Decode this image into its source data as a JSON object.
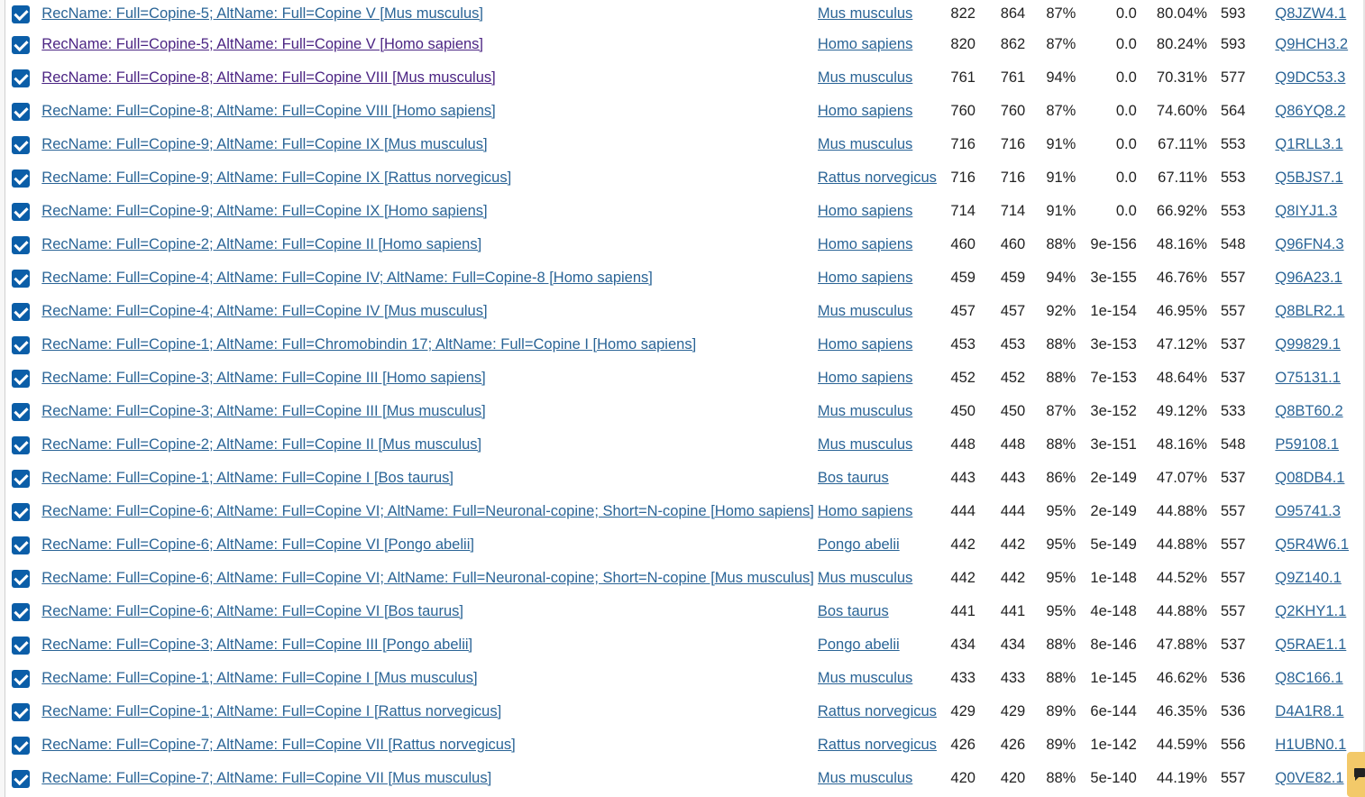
{
  "results": [
    {
      "description": "RecName: Full=Copine-5; AltName: Full=Copine V [Mus musculus]",
      "organism": "Mus musculus",
      "max_score": "822",
      "total_score": "864",
      "query_cover": "87%",
      "e_value": "0.0",
      "per_ident": "80.04%",
      "acc_len": "593",
      "accession": "Q8JZW4.1",
      "checked": true,
      "visited": false
    },
    {
      "description": "RecName: Full=Copine-5; AltName: Full=Copine V [Homo sapiens]",
      "organism": "Homo sapiens",
      "max_score": "820",
      "total_score": "862",
      "query_cover": "87%",
      "e_value": "0.0",
      "per_ident": "80.24%",
      "acc_len": "593",
      "accession": "Q9HCH3.2",
      "checked": true,
      "visited": true
    },
    {
      "description": "RecName: Full=Copine-8; AltName: Full=Copine VIII [Mus musculus]",
      "organism": "Mus musculus",
      "max_score": "761",
      "total_score": "761",
      "query_cover": "94%",
      "e_value": "0.0",
      "per_ident": "70.31%",
      "acc_len": "577",
      "accession": "Q9DC53.3",
      "checked": true,
      "visited": true
    },
    {
      "description": "RecName: Full=Copine-8; AltName: Full=Copine VIII [Homo sapiens]",
      "organism": "Homo sapiens",
      "max_score": "760",
      "total_score": "760",
      "query_cover": "87%",
      "e_value": "0.0",
      "per_ident": "74.60%",
      "acc_len": "564",
      "accession": "Q86YQ8.2",
      "checked": true,
      "visited": false
    },
    {
      "description": "RecName: Full=Copine-9; AltName: Full=Copine IX [Mus musculus]",
      "organism": "Mus musculus",
      "max_score": "716",
      "total_score": "716",
      "query_cover": "91%",
      "e_value": "0.0",
      "per_ident": "67.11%",
      "acc_len": "553",
      "accession": "Q1RLL3.1",
      "checked": true,
      "visited": false
    },
    {
      "description": "RecName: Full=Copine-9; AltName: Full=Copine IX [Rattus norvegicus]",
      "organism": "Rattus norvegicus",
      "max_score": "716",
      "total_score": "716",
      "query_cover": "91%",
      "e_value": "0.0",
      "per_ident": "67.11%",
      "acc_len": "553",
      "accession": "Q5BJS7.1",
      "checked": true,
      "visited": false
    },
    {
      "description": "RecName: Full=Copine-9; AltName: Full=Copine IX [Homo sapiens]",
      "organism": "Homo sapiens",
      "max_score": "714",
      "total_score": "714",
      "query_cover": "91%",
      "e_value": "0.0",
      "per_ident": "66.92%",
      "acc_len": "553",
      "accession": "Q8IYJ1.3",
      "checked": true,
      "visited": false
    },
    {
      "description": "RecName: Full=Copine-2; AltName: Full=Copine II [Homo sapiens]",
      "organism": "Homo sapiens",
      "max_score": "460",
      "total_score": "460",
      "query_cover": "88%",
      "e_value": "9e-156",
      "per_ident": "48.16%",
      "acc_len": "548",
      "accession": "Q96FN4.3",
      "checked": true,
      "visited": false
    },
    {
      "description": "RecName: Full=Copine-4; AltName: Full=Copine IV; AltName: Full=Copine-8 [Homo sapiens]",
      "organism": "Homo sapiens",
      "max_score": "459",
      "total_score": "459",
      "query_cover": "94%",
      "e_value": "3e-155",
      "per_ident": "46.76%",
      "acc_len": "557",
      "accession": "Q96A23.1",
      "checked": true,
      "visited": false
    },
    {
      "description": "RecName: Full=Copine-4; AltName: Full=Copine IV [Mus musculus]",
      "organism": "Mus musculus",
      "max_score": "457",
      "total_score": "457",
      "query_cover": "92%",
      "e_value": "1e-154",
      "per_ident": "46.95%",
      "acc_len": "557",
      "accession": "Q8BLR2.1",
      "checked": true,
      "visited": false
    },
    {
      "description": "RecName: Full=Copine-1; AltName: Full=Chromobindin 17; AltName: Full=Copine I [Homo sapiens]",
      "organism": "Homo sapiens",
      "max_score": "453",
      "total_score": "453",
      "query_cover": "88%",
      "e_value": "3e-153",
      "per_ident": "47.12%",
      "acc_len": "537",
      "accession": "Q99829.1",
      "checked": true,
      "visited": false
    },
    {
      "description": "RecName: Full=Copine-3; AltName: Full=Copine III [Homo sapiens]",
      "organism": "Homo sapiens",
      "max_score": "452",
      "total_score": "452",
      "query_cover": "88%",
      "e_value": "7e-153",
      "per_ident": "48.64%",
      "acc_len": "537",
      "accession": "O75131.1",
      "checked": true,
      "visited": false
    },
    {
      "description": "RecName: Full=Copine-3; AltName: Full=Copine III [Mus musculus]",
      "organism": "Mus musculus",
      "max_score": "450",
      "total_score": "450",
      "query_cover": "87%",
      "e_value": "3e-152",
      "per_ident": "49.12%",
      "acc_len": "533",
      "accession": "Q8BT60.2",
      "checked": true,
      "visited": false
    },
    {
      "description": "RecName: Full=Copine-2; AltName: Full=Copine II [Mus musculus]",
      "organism": "Mus musculus",
      "max_score": "448",
      "total_score": "448",
      "query_cover": "88%",
      "e_value": "3e-151",
      "per_ident": "48.16%",
      "acc_len": "548",
      "accession": "P59108.1",
      "checked": true,
      "visited": false
    },
    {
      "description": "RecName: Full=Copine-1; AltName: Full=Copine I [Bos taurus]",
      "organism": "Bos taurus",
      "max_score": "443",
      "total_score": "443",
      "query_cover": "86%",
      "e_value": "2e-149",
      "per_ident": "47.07%",
      "acc_len": "537",
      "accession": "Q08DB4.1",
      "checked": true,
      "visited": false
    },
    {
      "description": "RecName: Full=Copine-6; AltName: Full=Copine VI; AltName: Full=Neuronal-copine; Short=N-copine [Homo sapiens]",
      "organism": "Homo sapiens",
      "max_score": "444",
      "total_score": "444",
      "query_cover": "95%",
      "e_value": "2e-149",
      "per_ident": "44.88%",
      "acc_len": "557",
      "accession": "O95741.3",
      "checked": true,
      "visited": false
    },
    {
      "description": "RecName: Full=Copine-6; AltName: Full=Copine VI [Pongo abelii]",
      "organism": "Pongo abelii",
      "max_score": "442",
      "total_score": "442",
      "query_cover": "95%",
      "e_value": "5e-149",
      "per_ident": "44.88%",
      "acc_len": "557",
      "accession": "Q5R4W6.1",
      "checked": true,
      "visited": false
    },
    {
      "description": "RecName: Full=Copine-6; AltName: Full=Copine VI; AltName: Full=Neuronal-copine; Short=N-copine [Mus musculus]",
      "organism": "Mus musculus",
      "max_score": "442",
      "total_score": "442",
      "query_cover": "95%",
      "e_value": "1e-148",
      "per_ident": "44.52%",
      "acc_len": "557",
      "accession": "Q9Z140.1",
      "checked": true,
      "visited": false
    },
    {
      "description": "RecName: Full=Copine-6; AltName: Full=Copine VI [Bos taurus]",
      "organism": "Bos taurus",
      "max_score": "441",
      "total_score": "441",
      "query_cover": "95%",
      "e_value": "4e-148",
      "per_ident": "44.88%",
      "acc_len": "557",
      "accession": "Q2KHY1.1",
      "checked": true,
      "visited": false
    },
    {
      "description": "RecName: Full=Copine-3; AltName: Full=Copine III [Pongo abelii]",
      "organism": "Pongo abelii",
      "max_score": "434",
      "total_score": "434",
      "query_cover": "88%",
      "e_value": "8e-146",
      "per_ident": "47.88%",
      "acc_len": "537",
      "accession": "Q5RAE1.1",
      "checked": true,
      "visited": false
    },
    {
      "description": "RecName: Full=Copine-1; AltName: Full=Copine I [Mus musculus]",
      "organism": "Mus musculus",
      "max_score": "433",
      "total_score": "433",
      "query_cover": "88%",
      "e_value": "1e-145",
      "per_ident": "46.62%",
      "acc_len": "536",
      "accession": "Q8C166.1",
      "checked": true,
      "visited": false
    },
    {
      "description": "RecName: Full=Copine-1; AltName: Full=Copine I [Rattus norvegicus]",
      "organism": "Rattus norvegicus",
      "max_score": "429",
      "total_score": "429",
      "query_cover": "89%",
      "e_value": "6e-144",
      "per_ident": "46.35%",
      "acc_len": "536",
      "accession": "D4A1R8.1",
      "checked": true,
      "visited": false
    },
    {
      "description": "RecName: Full=Copine-7; AltName: Full=Copine VII [Rattus norvegicus]",
      "organism": "Rattus norvegicus",
      "max_score": "426",
      "total_score": "426",
      "query_cover": "89%",
      "e_value": "1e-142",
      "per_ident": "44.59%",
      "acc_len": "556",
      "accession": "H1UBN0.1",
      "checked": true,
      "visited": false
    },
    {
      "description": "RecName: Full=Copine-7; AltName: Full=Copine VII [Mus musculus]",
      "organism": "Mus musculus",
      "max_score": "420",
      "total_score": "420",
      "query_cover": "88%",
      "e_value": "5e-140",
      "per_ident": "44.19%",
      "acc_len": "557",
      "accession": "Q0VE82.1",
      "checked": true,
      "visited": false
    }
  ],
  "feedback": {
    "icon": "feedback-icon",
    "color": "#f3c969"
  },
  "colors": {
    "link": "#2a6496",
    "visited_link": "#4b2483",
    "checkbox": "#0b5ea8"
  }
}
